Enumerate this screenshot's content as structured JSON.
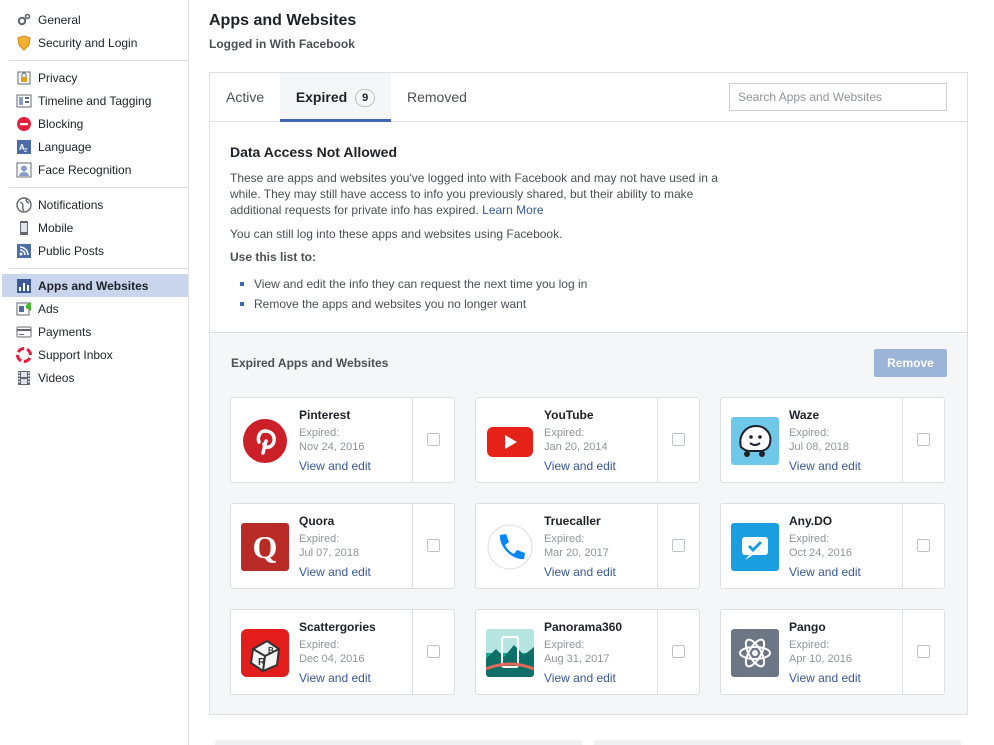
{
  "sidebar": {
    "groups": [
      [
        {
          "label": "General",
          "icon": "gears-icon"
        },
        {
          "label": "Security and Login",
          "icon": "badge-icon"
        }
      ],
      [
        {
          "label": "Privacy",
          "icon": "lock-icon"
        },
        {
          "label": "Timeline and Tagging",
          "icon": "timeline-icon"
        },
        {
          "label": "Blocking",
          "icon": "blocking-icon"
        },
        {
          "label": "Language",
          "icon": "language-icon"
        },
        {
          "label": "Face Recognition",
          "icon": "face-icon"
        }
      ],
      [
        {
          "label": "Notifications",
          "icon": "globe-icon"
        },
        {
          "label": "Mobile",
          "icon": "mobile-icon"
        },
        {
          "label": "Public Posts",
          "icon": "rss-icon"
        }
      ],
      [
        {
          "label": "Apps and Websites",
          "icon": "apps-icon",
          "active": true
        },
        {
          "label": "Ads",
          "icon": "ads-icon"
        },
        {
          "label": "Payments",
          "icon": "card-icon"
        },
        {
          "label": "Support Inbox",
          "icon": "lifebuoy-icon"
        },
        {
          "label": "Videos",
          "icon": "film-icon"
        }
      ]
    ]
  },
  "header": {
    "title": "Apps and Websites",
    "subtitle": "Logged in With Facebook"
  },
  "tabs": {
    "active": "Active",
    "expired": "Expired",
    "expired_count": "9",
    "removed": "Removed",
    "search_placeholder": "Search Apps and Websites"
  },
  "info": {
    "title": "Data Access Not Allowed",
    "paragraph1": "These are apps and websites you've logged into with Facebook and may not have used in a while. They may still have access to info you previously shared, but their ability to make additional requests for private info has expired.",
    "learn_more": "Learn More",
    "paragraph2": "You can still log into these apps and websites using Facebook.",
    "use_title": "Use this list to:",
    "bullets": [
      "View and edit the info they can request the next time you log in",
      "Remove the apps and websites you no longer want"
    ]
  },
  "expired": {
    "title": "Expired Apps and Websites",
    "remove_label": "Remove",
    "expired_label": "Expired:",
    "edit_label": "View and edit",
    "apps": [
      {
        "name": "Pinterest",
        "date": "Nov 24, 2016",
        "icon": "pinterest-icon"
      },
      {
        "name": "YouTube",
        "date": "Jan 20, 2014",
        "icon": "youtube-icon"
      },
      {
        "name": "Waze",
        "date": "Jul 08, 2018",
        "icon": "waze-icon"
      },
      {
        "name": "Quora",
        "date": "Jul 07, 2018",
        "icon": "quora-icon"
      },
      {
        "name": "Truecaller",
        "date": "Mar 20, 2017",
        "icon": "truecaller-icon"
      },
      {
        "name": "Any.DO",
        "date": "Oct 24, 2016",
        "icon": "anydo-icon"
      },
      {
        "name": "Scattergories",
        "date": "Dec 04, 2016",
        "icon": "scattergories-icon"
      },
      {
        "name": "Panorama360",
        "date": "Aug 31, 2017",
        "icon": "panorama-icon"
      },
      {
        "name": "Pango",
        "date": "Apr 10, 2016",
        "icon": "pango-icon"
      }
    ]
  },
  "colors": {
    "accent": "#4267b2",
    "link": "#385898",
    "active_nav": "#c9d5ec",
    "remove_button": "#9cb4d8"
  }
}
